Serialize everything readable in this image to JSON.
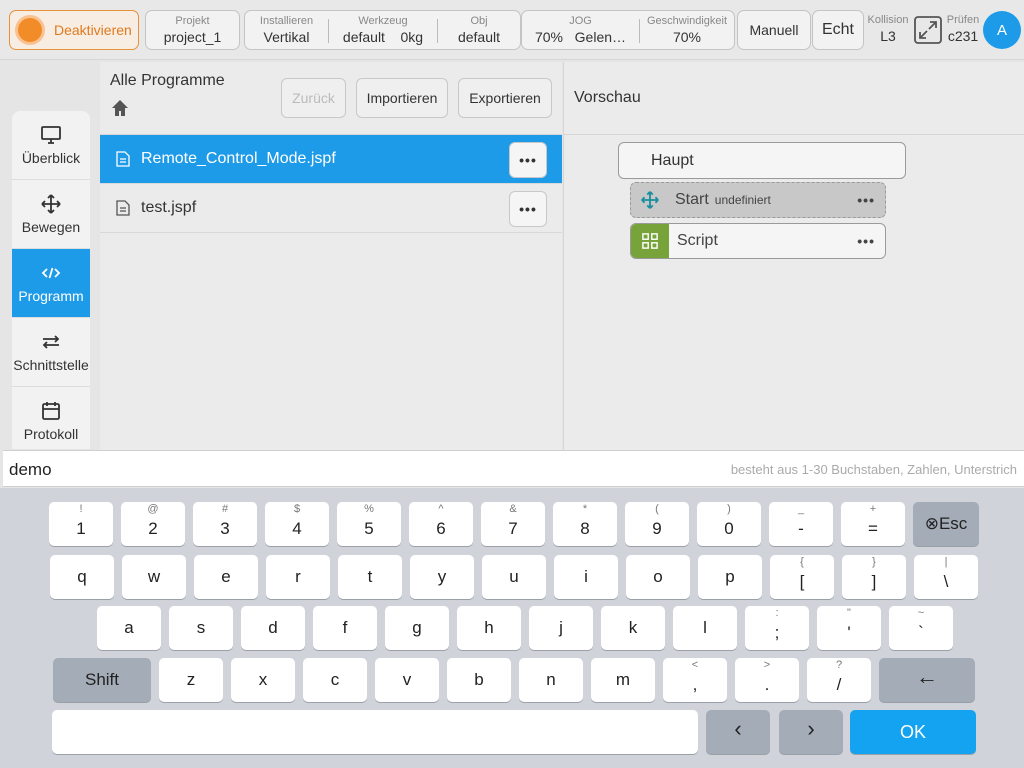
{
  "topbar": {
    "deactivate_label": "Deaktivieren",
    "project": {
      "key": "Projekt",
      "value": "project_1"
    },
    "installieren": {
      "key": "Installieren",
      "value": "Vertikal"
    },
    "werkzeug": {
      "key": "Werkzeug",
      "value": "default",
      "value2": "0kg"
    },
    "obj": {
      "key": "Obj",
      "value": "default"
    },
    "jog": {
      "key": "JOG",
      "value": "70%",
      "value2": "Gelen…"
    },
    "geschwindigkeit": {
      "key": "Geschwindigkeit",
      "value": "70%"
    },
    "manuell_label": "Manuell",
    "echt_label": "Echt",
    "kollision": {
      "key": "Kollision",
      "value": "L3"
    },
    "pruefen": {
      "key": "Prüfen",
      "value": "c231"
    },
    "avatar_letter": "A",
    "accent_color": "#1e9be8",
    "deactivate_color": "#f28c28"
  },
  "nav": {
    "items": [
      {
        "label": "Überblick",
        "icon": "monitor-icon"
      },
      {
        "label": "Bewegen",
        "icon": "move-icon"
      },
      {
        "label": "Programm",
        "icon": "code-icon",
        "active": true
      },
      {
        "label": "Schnittstelle",
        "icon": "swap-icon"
      },
      {
        "label": "Protokoll",
        "icon": "calendar-icon"
      }
    ]
  },
  "list": {
    "title": "Alle Programme",
    "back_label": "Zurück",
    "import_label": "Importieren",
    "export_label": "Exportieren",
    "files": [
      {
        "name": "Remote_Control_Mode.jspf",
        "selected": true
      },
      {
        "name": "test.jspf",
        "selected": false
      }
    ],
    "more_label": "•••"
  },
  "preview": {
    "title": "Vorschau",
    "root": "Haupt",
    "blocks": [
      {
        "label": "Start",
        "sub": "undefiniert",
        "icon": "move-icon"
      },
      {
        "label": "Script",
        "sub": "",
        "icon": "grid-icon"
      }
    ],
    "more_label": "•••"
  },
  "input": {
    "value": "demo",
    "hint": "besteht aus 1-30 Buchstaben, Zahlen, Unterstrich"
  },
  "keyboard": {
    "row1": [
      {
        "main": "1",
        "sub": "!"
      },
      {
        "main": "2",
        "sub": "@"
      },
      {
        "main": "3",
        "sub": "#"
      },
      {
        "main": "4",
        "sub": "$"
      },
      {
        "main": "5",
        "sub": "%"
      },
      {
        "main": "6",
        "sub": "^"
      },
      {
        "main": "7",
        "sub": "&"
      },
      {
        "main": "8",
        "sub": "*"
      },
      {
        "main": "9",
        "sub": "("
      },
      {
        "main": "0",
        "sub": ")"
      },
      {
        "main": "-",
        "sub": "_"
      },
      {
        "main": "=",
        "sub": "+"
      }
    ],
    "esc_label": "⊗Esc",
    "row2": [
      {
        "main": "q"
      },
      {
        "main": "w"
      },
      {
        "main": "e"
      },
      {
        "main": "r"
      },
      {
        "main": "t"
      },
      {
        "main": "y"
      },
      {
        "main": "u"
      },
      {
        "main": "i"
      },
      {
        "main": "o"
      },
      {
        "main": "p"
      },
      {
        "main": "[",
        "sub": "{"
      },
      {
        "main": "]",
        "sub": "}"
      },
      {
        "main": "\\",
        "sub": "|"
      }
    ],
    "row3": [
      {
        "main": "a"
      },
      {
        "main": "s"
      },
      {
        "main": "d"
      },
      {
        "main": "f"
      },
      {
        "main": "g"
      },
      {
        "main": "h"
      },
      {
        "main": "j"
      },
      {
        "main": "k"
      },
      {
        "main": "l"
      },
      {
        "main": ";",
        "sub": ":"
      },
      {
        "main": "'",
        "sub": "\""
      },
      {
        "main": "`",
        "sub": "~"
      }
    ],
    "shift_label": "Shift",
    "row4": [
      {
        "main": "z"
      },
      {
        "main": "x"
      },
      {
        "main": "c"
      },
      {
        "main": "v"
      },
      {
        "main": "b"
      },
      {
        "main": "n"
      },
      {
        "main": "m"
      },
      {
        "main": ",",
        "sub": "<"
      },
      {
        "main": ".",
        "sub": ">"
      },
      {
        "main": "/",
        "sub": "?"
      }
    ],
    "backspace_label": "←",
    "left_label": "‹",
    "right_label": "›",
    "ok_label": "OK"
  }
}
